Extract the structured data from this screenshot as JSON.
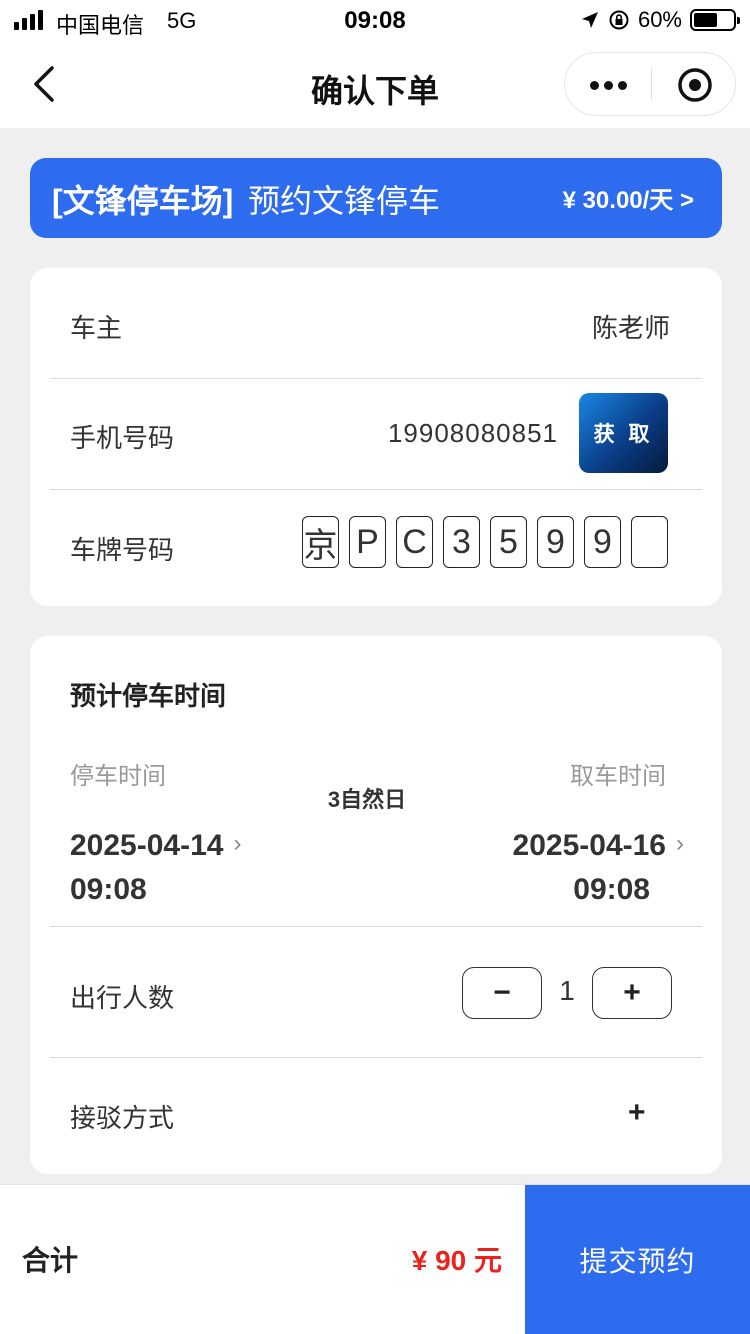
{
  "status_bar": {
    "carrier": "中国电信",
    "network": "5G",
    "time": "09:08",
    "battery": "60%",
    "battery_level": 0.6
  },
  "nav": {
    "title": "确认下单"
  },
  "banner": {
    "lot_name": "[文锋停车场]",
    "description": "预约文锋停车",
    "price": "¥ 30.00/天 >"
  },
  "owner": {
    "label": "车主",
    "value": "陈老师"
  },
  "phone": {
    "label": "手机号码",
    "value": "19908080851",
    "get_button": "获 取"
  },
  "plate": {
    "label": "车牌号码",
    "chars": [
      "京",
      "P",
      "C",
      "3",
      "5",
      "9",
      "9",
      ""
    ]
  },
  "schedule": {
    "title": "预计停车时间",
    "park_label": "停车时间",
    "pickup_label": "取车时间",
    "days": "3自然日",
    "park_date": "2025-04-14",
    "park_time": "09:08",
    "pickup_date": "2025-04-16",
    "pickup_time": "09:08"
  },
  "travelers": {
    "label": "出行人数",
    "minus": "−",
    "value": "1",
    "plus": "+"
  },
  "shuttle": {
    "label": "接驳方式",
    "add": "+"
  },
  "footer": {
    "total_label": "合计",
    "total_amount": "¥ 90 元",
    "submit": "提交预约"
  },
  "colors": {
    "primary": "#2d6bef",
    "price_red": "#e8241c",
    "background": "#efefef"
  }
}
